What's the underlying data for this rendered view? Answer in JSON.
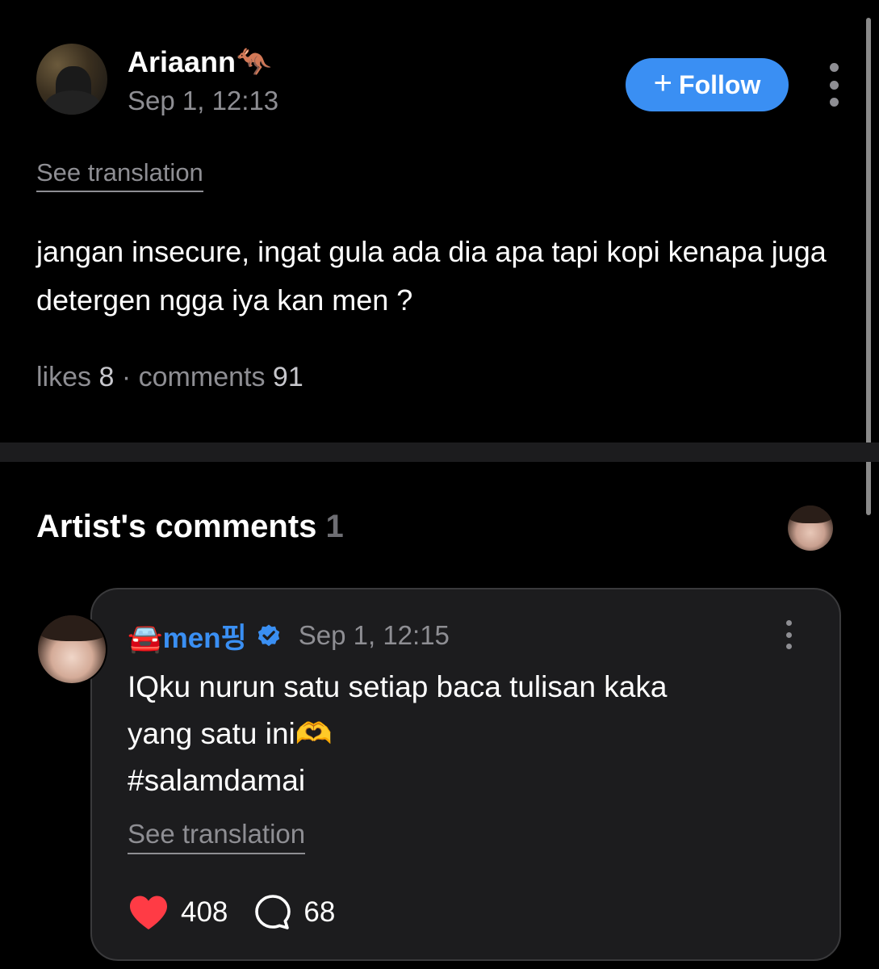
{
  "post": {
    "author": "Ariaann🦘",
    "timestamp": "Sep 1, 12:13",
    "follow_label": "Follow",
    "see_translation": "See translation",
    "body": "jangan insecure, ingat gula ada dia apa tapi kopi kenapa juga detergen ngga iya kan men ?",
    "likes_label": "likes",
    "likes_count": "8",
    "stats_separator": "·",
    "comments_label": "comments",
    "comments_count": "91"
  },
  "artist_comments": {
    "heading": "Artist's comments",
    "count": "1",
    "comment": {
      "author": "🚘men핑",
      "timestamp": "Sep 1, 12:15",
      "body_lines": [
        "IQku nurun satu setiap baca tulisan kaka",
        "yang satu ini🫶",
        "#salamdamai"
      ],
      "see_translation": "See translation",
      "likes": "408",
      "replies": "68"
    }
  },
  "icons": {
    "follow": "plus-icon",
    "more": "more-vertical-icon",
    "verified": "verified-badge-icon",
    "like": "heart-icon",
    "reply": "comment-bubble-icon"
  },
  "colors": {
    "background": "#000000",
    "accent": "#3a8ff3",
    "muted_text": "#8e8e93",
    "card_background": "#1c1c1e",
    "heart": "#ff3b45"
  }
}
